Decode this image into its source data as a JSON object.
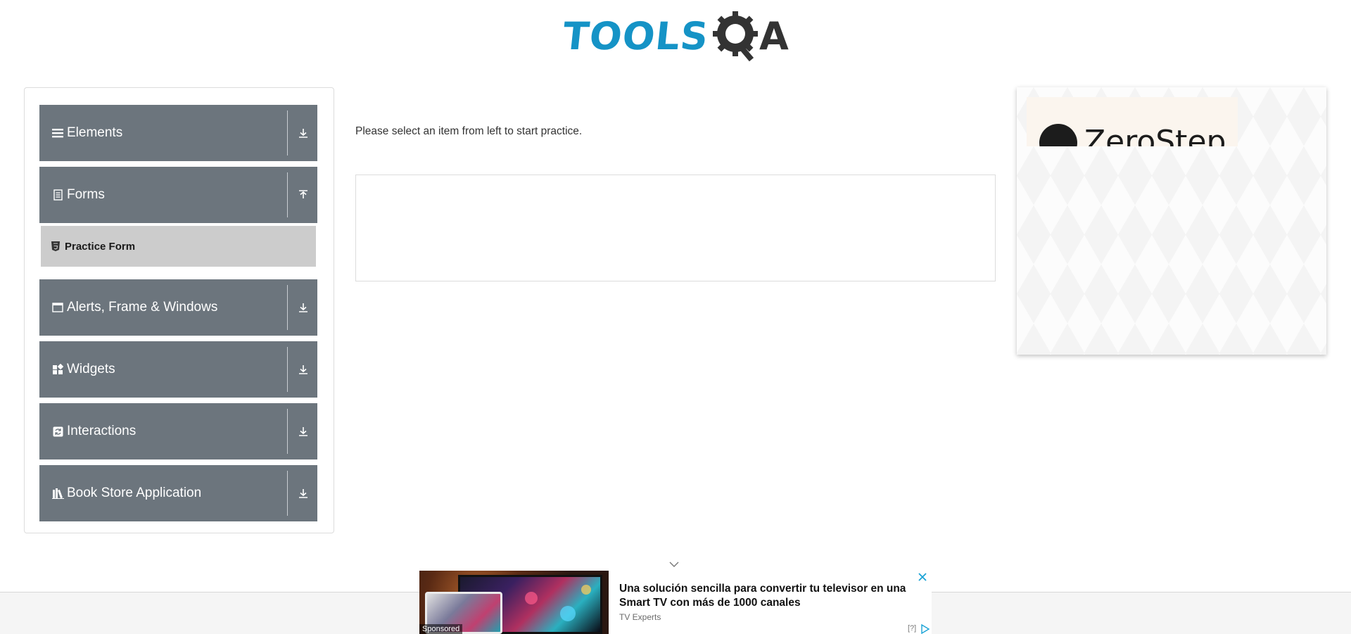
{
  "header": {
    "logo_text_primary": "TOOLS",
    "logo_text_secondary": "A",
    "logo_icon": "gear-magnifier-icon",
    "brand_color": "#1593c6"
  },
  "sidebar": {
    "groups": [
      {
        "label": "Elements",
        "icon": "hamburger-icon",
        "arrow": "download-arrow-icon"
      },
      {
        "label": "Forms",
        "icon": "document-icon",
        "arrow": "upload-arrow-icon",
        "expanded": true,
        "items": [
          {
            "label": "Practice Form",
            "icon": "html5-icon"
          }
        ]
      },
      {
        "label": "Alerts, Frame & Windows",
        "icon": "window-icon",
        "arrow": "download-arrow-icon"
      },
      {
        "label": "Widgets",
        "icon": "widgets-icon",
        "arrow": "download-arrow-icon"
      },
      {
        "label": "Interactions",
        "icon": "interactions-icon",
        "arrow": "download-arrow-icon"
      },
      {
        "label": "Book Store Application",
        "icon": "books-icon",
        "arrow": "download-arrow-icon"
      }
    ],
    "group_color": "#6c757d",
    "active_item_color": "#cccccc"
  },
  "main": {
    "prompt": "Please select an item from left to start practice."
  },
  "ad_right": {
    "brand": "ZeroStep"
  },
  "ad_bottom": {
    "title": "Una solución sencilla para convertir tu televisor en una Smart TV con más de 1000 canales",
    "source": "TV Experts",
    "sponsored_label": "Sponsored",
    "info_label": "[?]"
  }
}
